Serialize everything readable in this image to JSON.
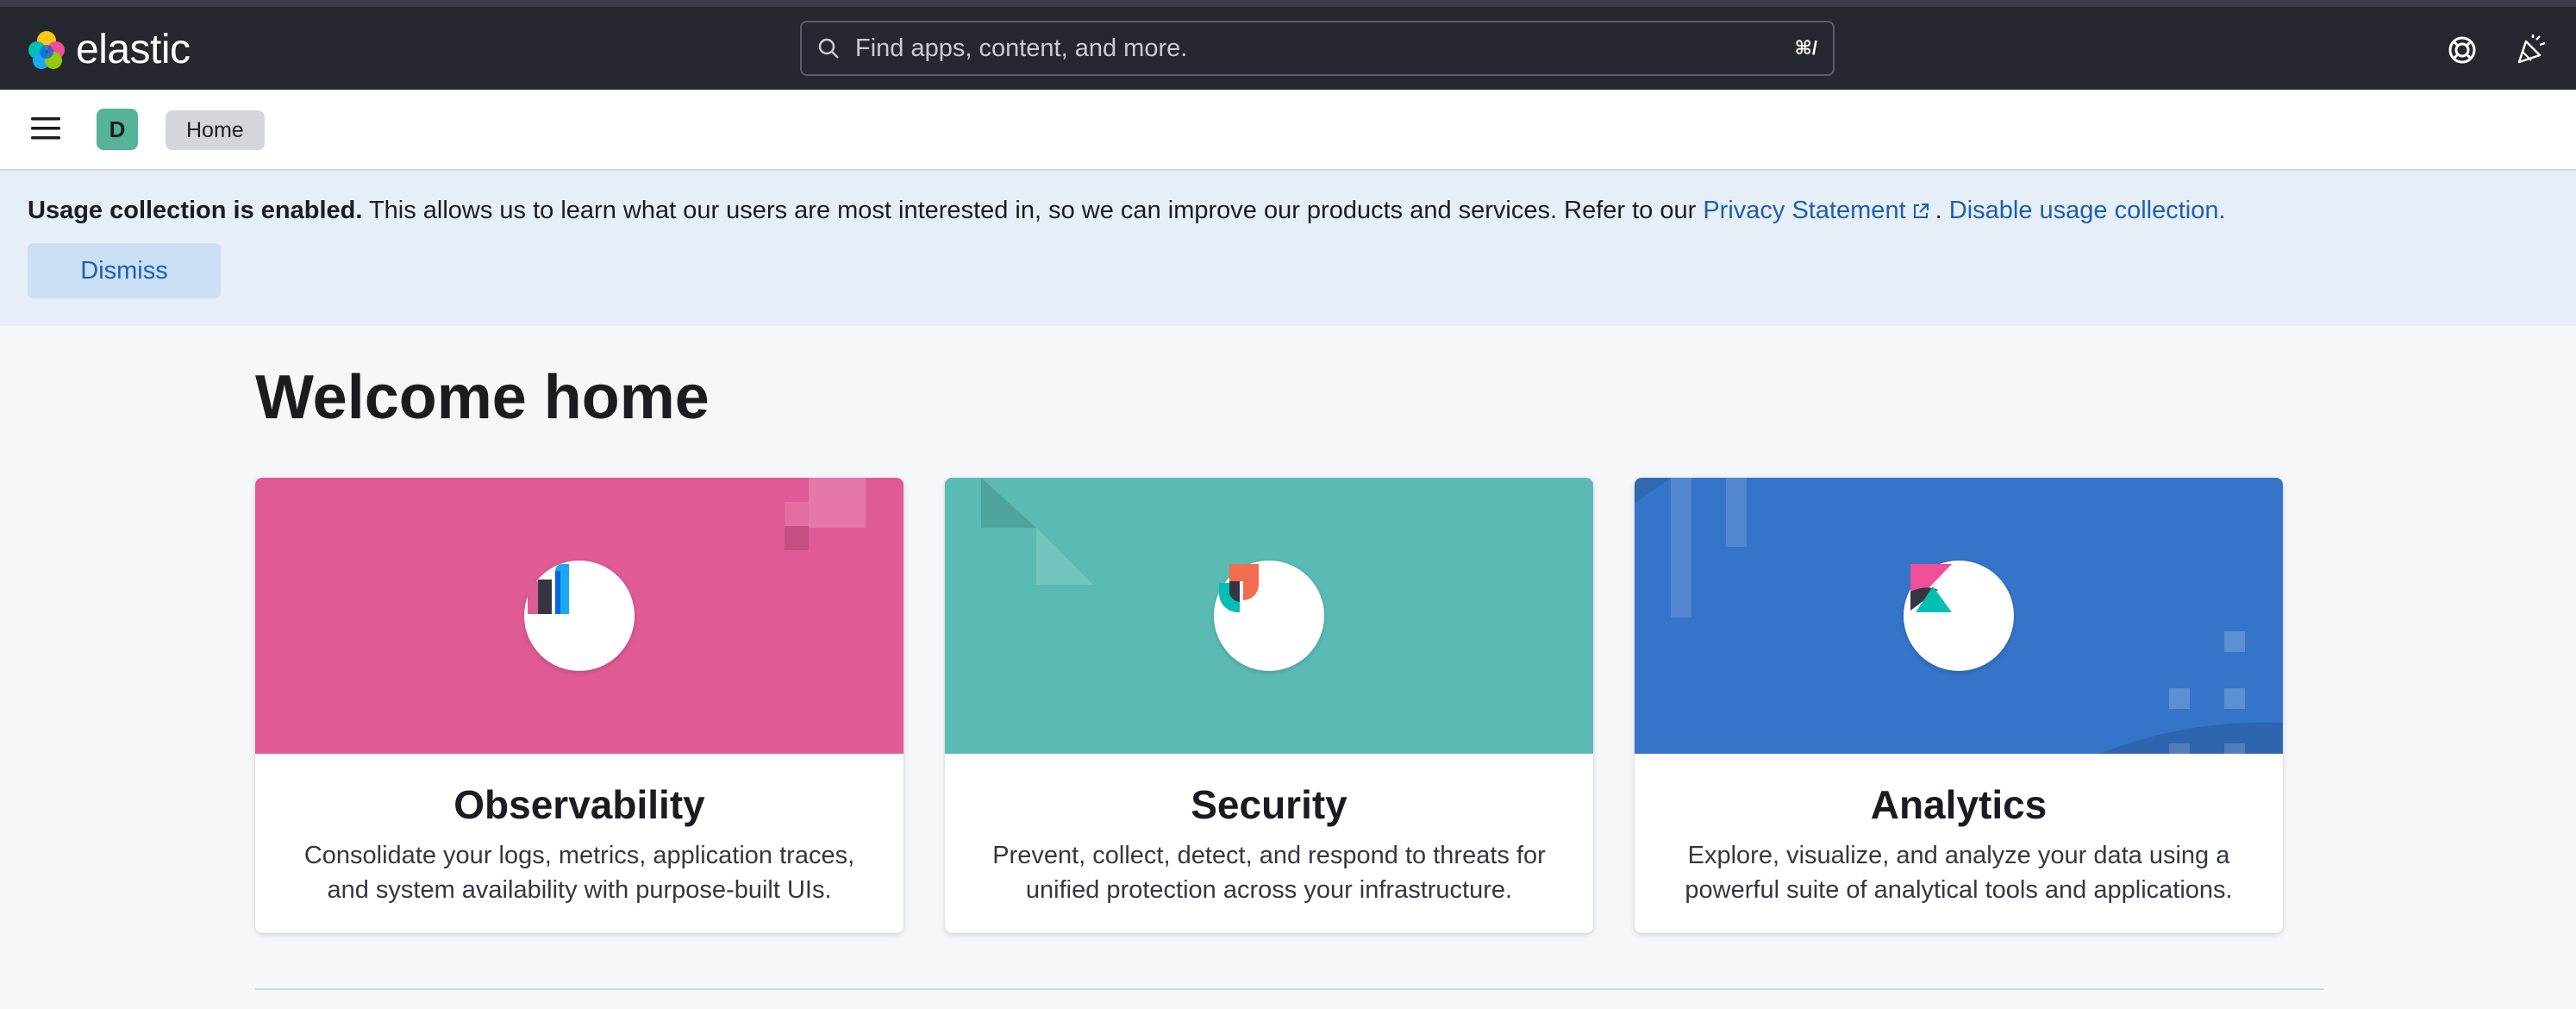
{
  "topbar": {
    "logo_text": "elastic",
    "search_placeholder": "Find apps, content, and more.",
    "search_shortcut": "⌘/"
  },
  "header": {
    "avatar_initial": "D",
    "breadcrumb": "Home"
  },
  "callout": {
    "bold": "Usage collection is enabled.",
    "text": " This allows us to learn what our users are most interested in, so we can improve our products and services. Refer to our ",
    "privacy_link": "Privacy Statement",
    "period": ".",
    "disable_link": "Disable usage collection.",
    "dismiss_label": "Dismiss"
  },
  "page_title": "Welcome home",
  "cards": [
    {
      "title": "Observability",
      "desc": "Consolidate your logs, metrics, application traces, and system availability with purpose-built UIs.",
      "color": "#e05a96"
    },
    {
      "title": "Security",
      "desc": "Prevent, collect, detect, and respond to threats for unified protection across your infrastructure.",
      "color": "#5bbab3"
    },
    {
      "title": "Analytics",
      "desc": "Explore, visualize, and analyze your data using a powerful suite of analytical tools and applications.",
      "color": "#3574c8"
    }
  ],
  "icons": {
    "help": "help-icon",
    "newsfeed": "newsfeed-icon",
    "menu": "menu-icon",
    "search": "search-icon"
  }
}
